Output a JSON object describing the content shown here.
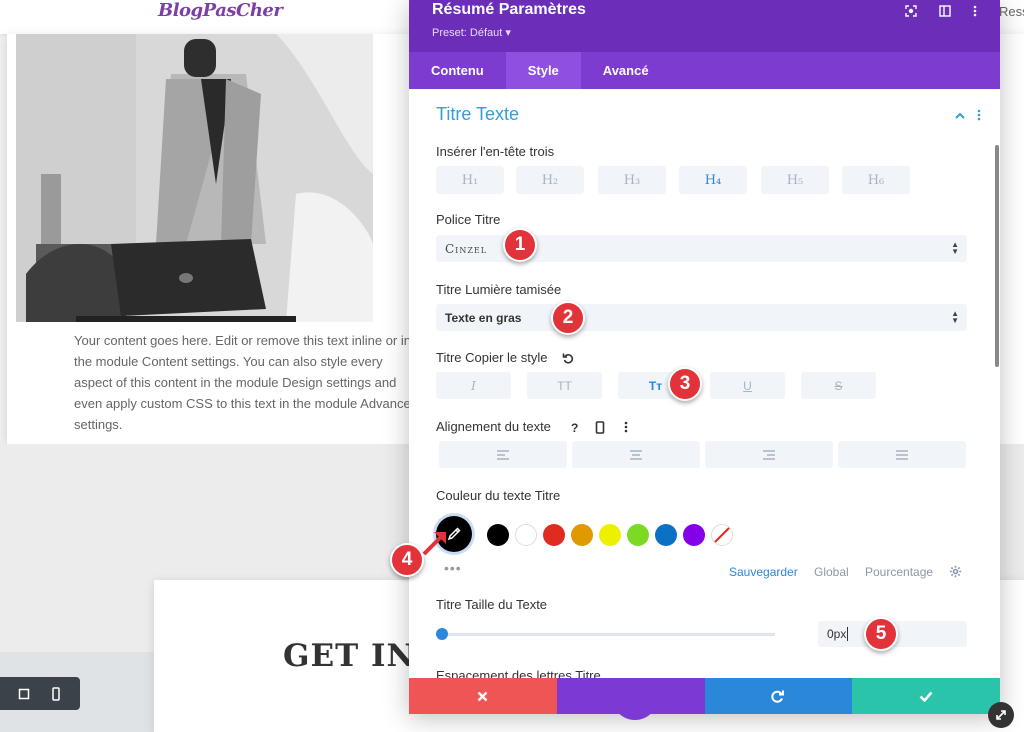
{
  "site": {
    "logo": "BlogPasCher",
    "top_link": "Ress",
    "body_text": "Your content goes here. Edit or remove this text inline or in the module Content settings. You can also style every aspect of this content in the module Design settings and even apply custom CSS to this text in the module Advanced settings.",
    "contact_heading": "GET IN"
  },
  "panel": {
    "title": "Résumé Paramètres",
    "preset": "Preset: Défaut ▾",
    "tabs": [
      {
        "label": "Contenu"
      },
      {
        "label": "Style"
      },
      {
        "label": "Avancé"
      }
    ],
    "active_tab": "Style",
    "section_title": "Titre Texte",
    "heading_level": {
      "label": "Insérer l'en-tête trois",
      "options": [
        "H₁",
        "H₂",
        "H₃",
        "H₄",
        "H₅",
        "H₆"
      ],
      "selected": "H₄"
    },
    "font": {
      "label": "Police Titre",
      "value": "Cinzel"
    },
    "weight": {
      "label": "Titre Lumière tamisée",
      "value": "Texte en gras"
    },
    "style": {
      "label": "Titre Copier le style",
      "options": [
        "I",
        "TT",
        "Tт",
        "U",
        "S"
      ],
      "selected": "Tт"
    },
    "alignment": {
      "label": "Alignement du texte"
    },
    "color": {
      "label": "Couleur du texte Titre",
      "current": "#000000",
      "swatches": [
        "#000000",
        "#ffffff",
        "#e02b20",
        "#e09900",
        "#edf000",
        "#7cda24",
        "#0c71c3",
        "#8300e9"
      ],
      "links": [
        "Sauvegarder",
        "Global",
        "Pourcentage"
      ]
    },
    "size": {
      "label": "Titre Taille du Texte",
      "value": "0px",
      "slider_fraction": 0
    },
    "next_label": "Espacement des lettres Titre"
  },
  "badges": [
    "1",
    "2",
    "3",
    "4",
    "5"
  ],
  "colors": {
    "header": "#6c2eb9",
    "tabs": "#7e3bd0",
    "accent": "#2b87da",
    "section_title": "#2e9ee0",
    "badge": "#e2333b",
    "close": "#ef5555",
    "undo": "#7c39d3",
    "redo": "#2b87da",
    "save": "#29c4a9"
  }
}
